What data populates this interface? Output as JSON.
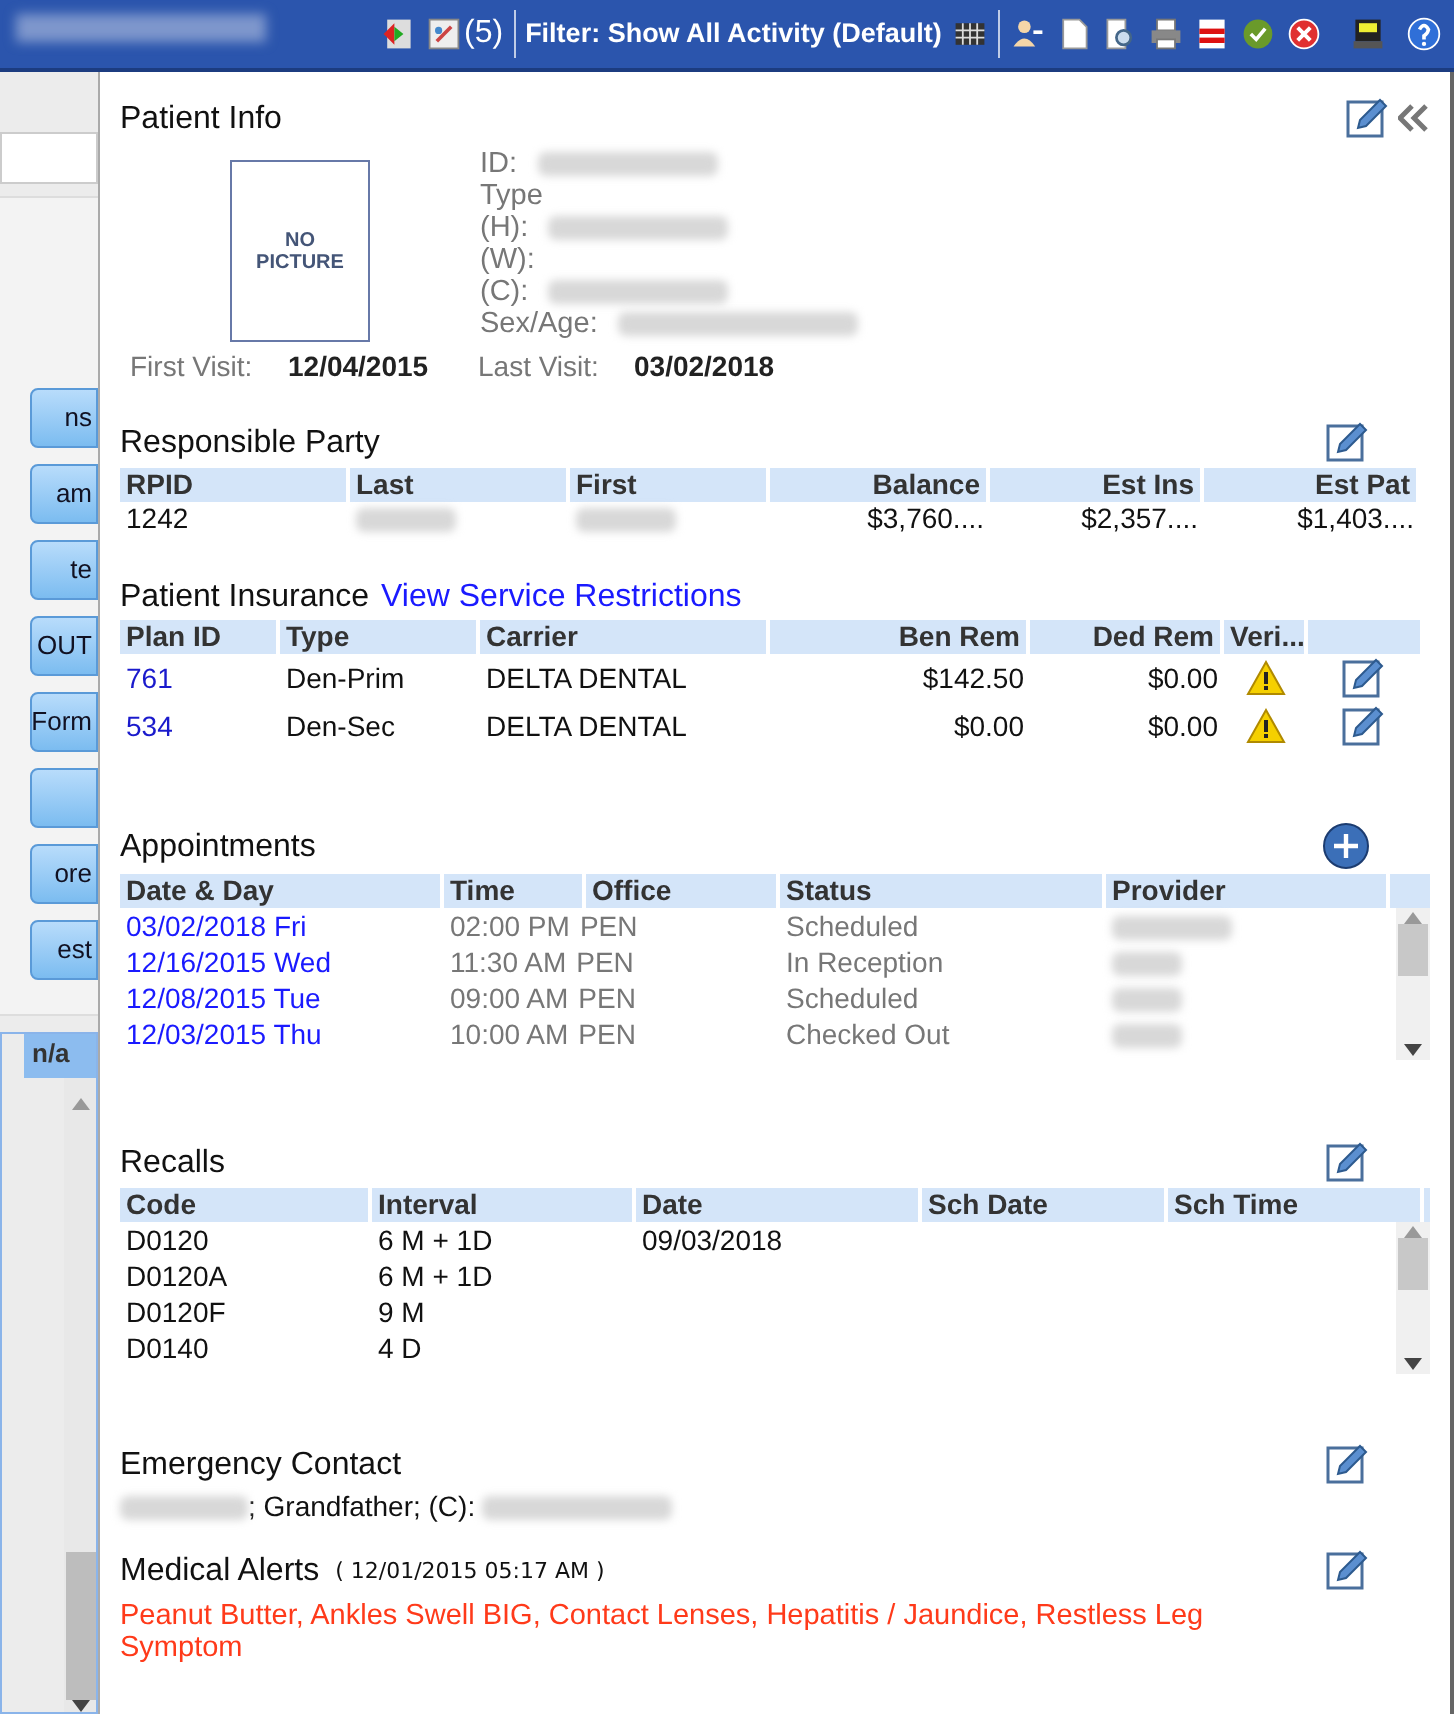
{
  "toolbar": {
    "count": "(5)",
    "filter": "Filter: Show All Activity (Default)"
  },
  "left_panel": {
    "buttons": [
      {
        "kind": "text",
        "label": "ns"
      },
      {
        "kind": "text",
        "label": "am"
      },
      {
        "kind": "text",
        "label": "te"
      },
      {
        "kind": "text",
        "label": "OUT"
      },
      {
        "kind": "text",
        "label": "Form"
      },
      {
        "kind": "blank"
      },
      {
        "kind": "text",
        "label": "ore"
      },
      {
        "kind": "text",
        "label": "est"
      }
    ],
    "grid_cell": "n/a"
  },
  "patient_info": {
    "title": "Patient Info",
    "picture_text": "NO PICTURE",
    "fields": [
      {
        "label": "ID:",
        "redacted": true
      },
      {
        "label": "Type",
        "redacted": false
      },
      {
        "label": "(H):",
        "redacted": true
      },
      {
        "label": "(W):",
        "redacted": false
      },
      {
        "label": "(C):",
        "redacted": true
      },
      {
        "label": "Sex/Age:",
        "redacted": true
      }
    ],
    "first_visit_label": "First Visit:",
    "first_visit": "12/04/2015",
    "last_visit_label": "Last Visit:",
    "last_visit": "03/02/2018"
  },
  "responsible_party": {
    "title": "Responsible Party",
    "columns": [
      {
        "label": "RPID",
        "numeric": false
      },
      {
        "label": "Last",
        "numeric": false
      },
      {
        "label": "First",
        "numeric": false
      },
      {
        "label": "Balance",
        "numeric": true
      },
      {
        "label": "Est Ins",
        "numeric": true
      },
      {
        "label": "Est Pat",
        "numeric": true
      }
    ],
    "rows": [
      [
        {
          "text": "1242"
        },
        {
          "redacted": true
        },
        {
          "redacted": true
        },
        {
          "text": "$3,760...."
        },
        {
          "text": "$2,357...."
        },
        {
          "text": "$1,403...."
        }
      ]
    ]
  },
  "patient_insurance": {
    "title": "Patient Insurance",
    "link": "View Service Restrictions",
    "columns": [
      "Plan ID",
      "Type",
      "Carrier",
      "Ben Rem",
      "Ded Rem",
      "Veri..."
    ],
    "rows": [
      {
        "plan_id": "761",
        "type": "Den-Prim",
        "carrier": "DELTA DENTAL",
        "ben_rem": "$142.50",
        "ded_rem": "$0.00",
        "verified": false
      },
      {
        "plan_id": "534",
        "type": "Den-Sec",
        "carrier": "DELTA DENTAL",
        "ben_rem": "$0.00",
        "ded_rem": "$0.00",
        "verified": false
      }
    ]
  },
  "appointments": {
    "title": "Appointments",
    "columns": [
      "Date & Day",
      "Time",
      "Office",
      "Status",
      "Provider"
    ],
    "rows": [
      {
        "date_day": "03/02/2018 Fri",
        "time": "02:00 PM",
        "office": "PEN",
        "status": "Scheduled"
      },
      {
        "date_day": "12/16/2015 Wed",
        "time": "11:30 AM",
        "office": "PEN",
        "status": "In Reception"
      },
      {
        "date_day": "12/08/2015 Tue",
        "time": "09:00 AM",
        "office": "PEN",
        "status": "Scheduled"
      },
      {
        "date_day": "12/03/2015 Thu",
        "time": "10:00 AM",
        "office": "PEN",
        "status": "Checked Out"
      }
    ]
  },
  "recalls": {
    "title": "Recalls",
    "columns": [
      "Code",
      "Interval",
      "Date",
      "Sch Date",
      "Sch Time"
    ],
    "rows": [
      {
        "code": "D0120",
        "interval": "6 M + 1D",
        "date": "09/03/2018"
      },
      {
        "code": "D0120A",
        "interval": "6 M + 1D"
      },
      {
        "code": "D0120F",
        "interval": "9 M"
      },
      {
        "code": "D0140",
        "interval": "4 D"
      }
    ]
  },
  "emergency_contact": {
    "title": "Emergency Contact",
    "parts": [
      {
        "redacted": true
      },
      {
        "text": "; Grandfather; (C): "
      },
      {
        "redacted": true
      }
    ]
  },
  "medical_alerts": {
    "title": "Medical Alerts",
    "timestamp": "( 12/01/2015 05:17 AM )",
    "alerts": "Peanut Butter, Ankles Swell BIG, Contact Lenses, Hepatitis / Jaundice, Restless Leg Symptom"
  }
}
